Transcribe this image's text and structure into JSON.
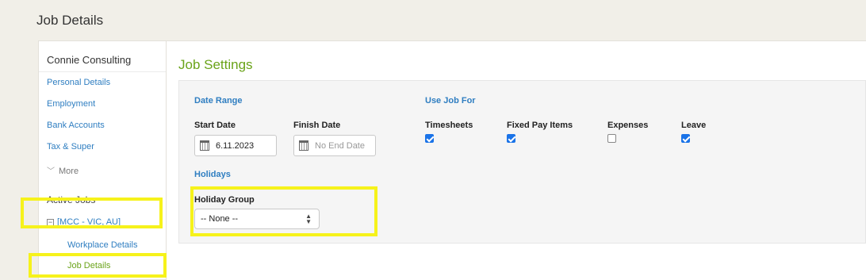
{
  "page": {
    "title": "Job Details"
  },
  "sidebar": {
    "company": "Connie Consulting",
    "links": [
      {
        "label": "Personal Details"
      },
      {
        "label": "Employment"
      },
      {
        "label": "Bank Accounts"
      },
      {
        "label": "Tax & Super"
      }
    ],
    "more_label": "More",
    "active_jobs_heading": "Active Jobs",
    "job": {
      "label": "[MCC - VIC, AU]",
      "collapse_glyph": "−",
      "children": [
        {
          "label": "Workplace Details",
          "active": false
        },
        {
          "label": "Job Details",
          "active": true
        }
      ]
    }
  },
  "main": {
    "title": "Job Settings",
    "date_range": {
      "heading": "Date Range",
      "start_label": "Start Date",
      "start_value": "6.11.2023",
      "finish_label": "Finish Date",
      "finish_placeholder": "No End Date"
    },
    "use_job_for": {
      "heading": "Use Job For",
      "options": [
        {
          "label": "Timesheets",
          "checked": true
        },
        {
          "label": "Fixed Pay Items",
          "checked": true
        },
        {
          "label": "Expenses",
          "checked": false
        },
        {
          "label": "Leave",
          "checked": true
        }
      ]
    },
    "holidays": {
      "heading": "Holidays",
      "group_label": "Holiday Group",
      "group_value": "-- None --"
    }
  },
  "colors": {
    "link": "#2f7ec1",
    "accent_green": "#6aa319",
    "highlight_yellow": "#f6f21b",
    "checkbox_blue": "#1a73e8"
  }
}
